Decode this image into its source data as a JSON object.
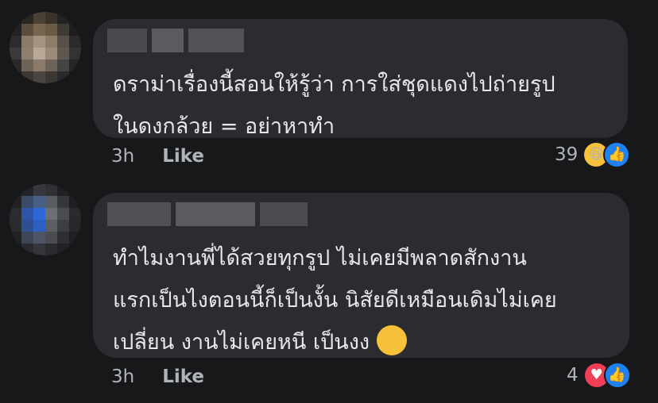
{
  "comments": [
    {
      "text_lines": [
        "ดราม่าเรื่องนี้สอนให้รู้ว่า การใส่ชุดแดงไปถ่ายรูป",
        "ในดงกล้วย = อย่าหาทำ"
      ],
      "time": "3h",
      "like_label": "Like",
      "reaction_count": "39",
      "reactions": [
        "haha-icon",
        "like-icon"
      ]
    },
    {
      "text_lines": [
        "ทำไมงานพี่ได้สวยทุกรูป ไม่เคยมีพลาดสักงาน",
        "แรกเป็นไงตอนนี้ก็เป็นงั้น นิสัยดีเหมือนเดิมไม่เคย",
        "เปลี่ยน งานไม่เคยหนี เป็นงง"
      ],
      "time": "3h",
      "like_label": "Like",
      "reaction_count": "4",
      "reactions": [
        "love-icon",
        "like-icon"
      ]
    }
  ],
  "colors": {
    "background": "#17181a",
    "bubble": "#2b2c2f",
    "text": "#e6e7ea",
    "meta": "#b0b3b8"
  }
}
